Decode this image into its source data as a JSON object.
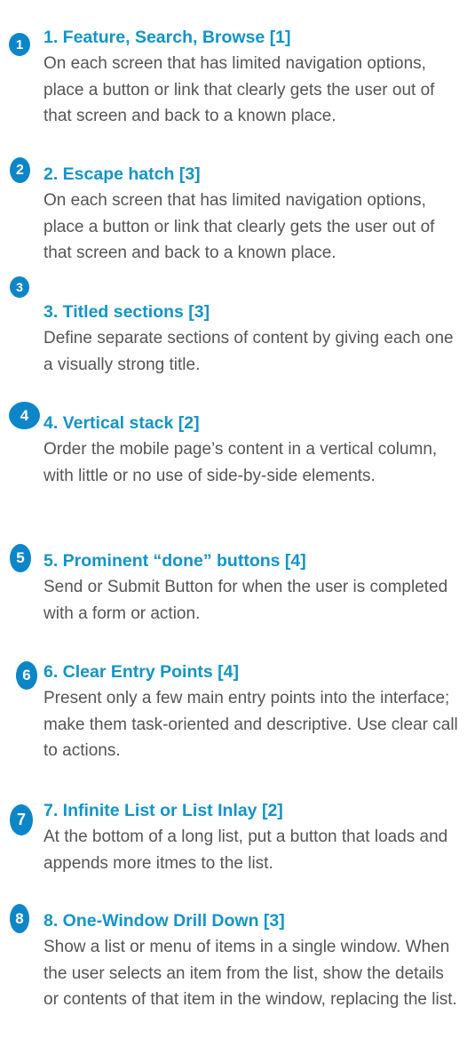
{
  "items": [
    {
      "number": "1",
      "title": "1. Feature, Search, Browse [1]",
      "description": "On each screen that has limited navigation options, place a button or link that clearly gets the user out of that screen and back to a known place."
    },
    {
      "number": "2",
      "title": "2. Escape hatch [3]",
      "description": "On each screen that has limited navigation options, place a button or link that clearly gets the user out of that screen and back to a known place."
    },
    {
      "number": "3",
      "title": "3. Titled sections [3]",
      "description": "Define separate sections of content by giving each one a visually strong title."
    },
    {
      "number": "4",
      "title": "4. Vertical stack [2]",
      "description": "Order the mobile page’s content in a vertical column, with little or no use of side-by-side elements."
    },
    {
      "number": "5",
      "title": "5. Prominent “done” buttons [4]",
      "description": "Send or Submit Button for when the user is completed with a form or action."
    },
    {
      "number": "6",
      "title": "6. Clear Entry Points [4]",
      "description": "Present only a few main entry points into the interface; make them task-oriented and descriptive. Use clear call to actions."
    },
    {
      "number": "7",
      "title": "7. Infinite List or List Inlay [2]",
      "description": "At the bottom of a long list, put a button that loads and appends more itmes to the list."
    },
    {
      "number": "8",
      "title": "8. One-Window Drill Down  [3]",
      "description": "Show a list or menu of items in a single window. When the user selects an item from the list, show the details or contents of that item in the window, replacing the list."
    }
  ],
  "colors": {
    "badge": "#0d86c9",
    "title": "#1494c8",
    "text": "#555555"
  }
}
